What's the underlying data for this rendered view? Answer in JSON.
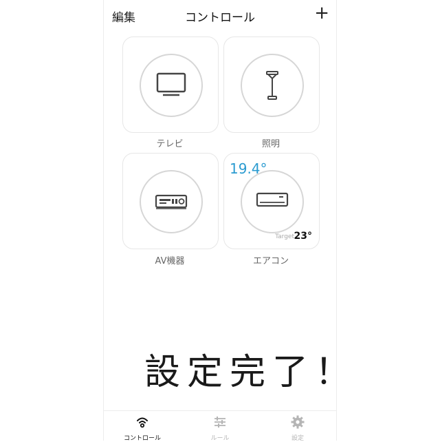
{
  "header": {
    "edit_label": "編集",
    "title": "コントロール",
    "add_label": "+"
  },
  "devices": [
    {
      "label": "テレビ",
      "icon": "tv-icon"
    },
    {
      "label": "照明",
      "icon": "floor-lamp-icon"
    },
    {
      "label": "AV機器",
      "icon": "av-receiver-icon"
    },
    {
      "label": "エアコン",
      "icon": "air-conditioner-icon",
      "current_temp": "19.4°",
      "target_label": "Target",
      "target_temp": "23°"
    }
  ],
  "overlay_text": "設定完了！",
  "tabs": [
    {
      "label": "コントロール",
      "icon": "wifi-icon",
      "active": true
    },
    {
      "label": "ルール",
      "icon": "sliders-icon",
      "active": false
    },
    {
      "label": "設定",
      "icon": "gear-icon",
      "active": false
    }
  ],
  "colors": {
    "accent_temp": "#2b9bd0",
    "active_tab": "#111111",
    "inactive_tab": "#b5b5b5"
  }
}
